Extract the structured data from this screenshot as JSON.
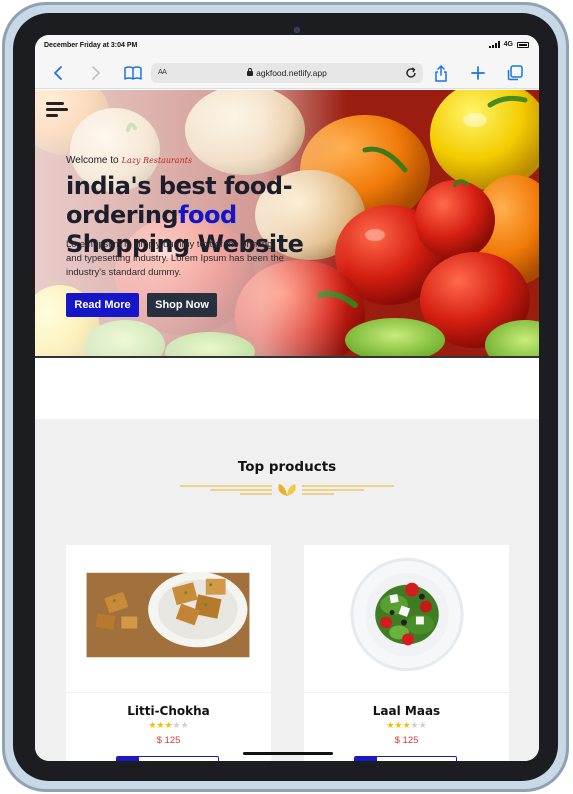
{
  "status_bar": {
    "time": "December Friday at 3:04 PM",
    "network": "4G"
  },
  "browser": {
    "text_size_label": "AA",
    "url": "agkfood.netlify.app",
    "icons": [
      "back-icon",
      "forward-icon",
      "bookmarks-icon",
      "reload-icon",
      "share-icon",
      "new-tab-icon",
      "tabs-icon"
    ]
  },
  "hero": {
    "welcome_label": "Welcome to",
    "brand_script": "Lazy Restaurants",
    "headline_line1": "india's best food-ordering",
    "headline_accent": "food",
    "headline_line2": "Shopping Website",
    "description": "Lorem Ipsum is simply dummy text of the printing and typesetting industry. Lorem Ipsum has been the industry's standard dummy.",
    "read_more": "Read More",
    "shop_now": "Shop Now",
    "colors": {
      "read_more_bg": "#1616c9",
      "shop_now_bg": "#26303f",
      "accent_text": "#1515c8"
    }
  },
  "top_products": {
    "title": "Top products",
    "items": [
      {
        "name": "Litti-Chokha",
        "rating": 3,
        "max_rating": 5,
        "price": "$ 125",
        "image": "sweets-plate"
      },
      {
        "name": "Laal Maas",
        "rating": 3,
        "max_rating": 5,
        "price": "$ 125",
        "image": "salad-bowl"
      }
    ]
  }
}
